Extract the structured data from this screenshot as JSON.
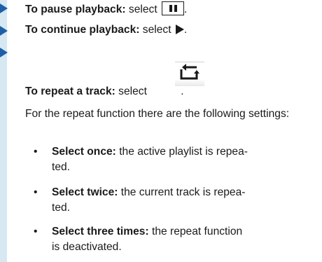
{
  "steps": [
    {
      "label": "To pause playback:",
      "rest": " select "
    },
    {
      "label": "To continue playback:",
      "rest": " select "
    },
    {
      "label": "To repeat a track:",
      "rest": " select "
    }
  ],
  "punct": ".",
  "intro": "For the repeat function there are the following settings:",
  "bullets": [
    {
      "label": "Select once:",
      "line1": " the active playlist is repea-",
      "line2": "ted."
    },
    {
      "label": "Select twice:",
      "line1": " the current track is repea-",
      "line2": "ted."
    },
    {
      "label": "Select three times:",
      "line1": " the repeat function",
      "line2": "is deactivated."
    }
  ],
  "bullet_symbol": "•",
  "icons": [
    "pause-icon",
    "play-icon",
    "repeat-icon"
  ],
  "colors": {
    "accent_bar": "#d7e8f3",
    "step_arrow": "#1f5fa8"
  }
}
